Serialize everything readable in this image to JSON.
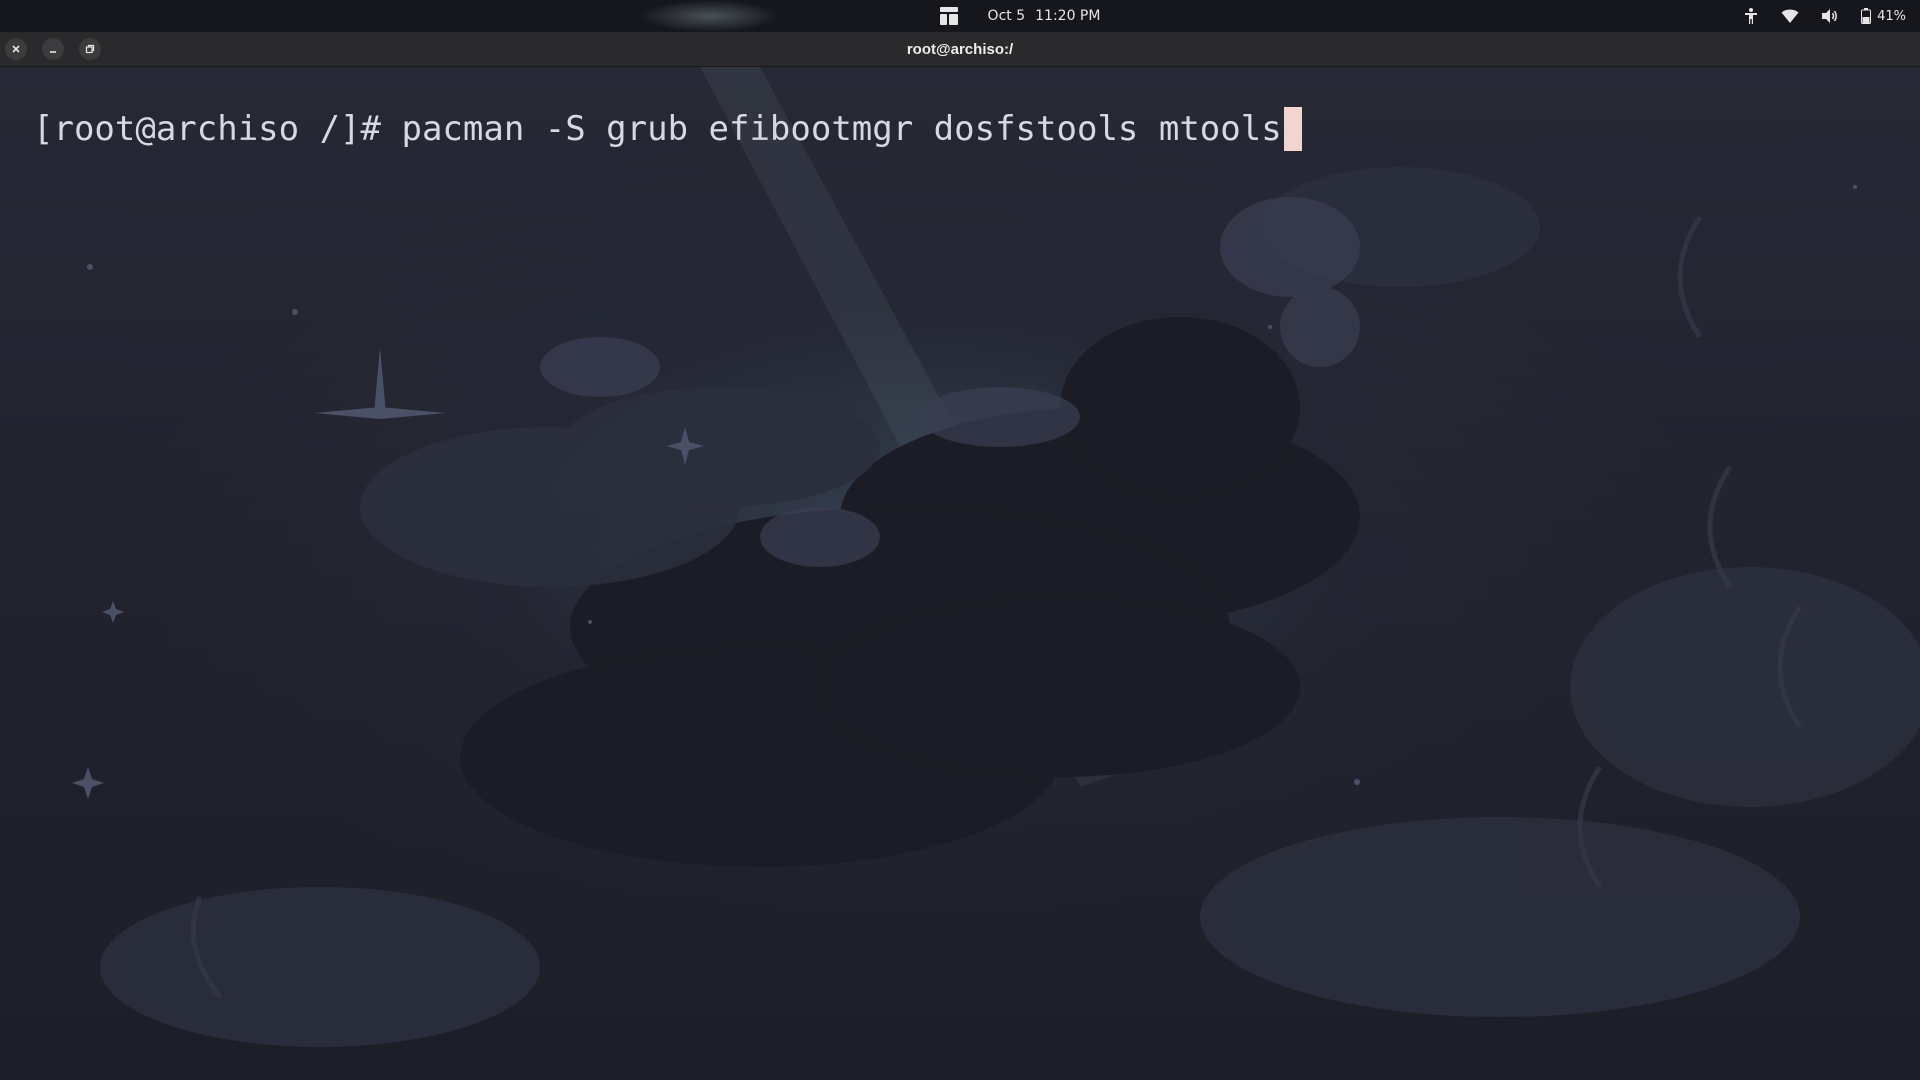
{
  "topbar": {
    "date": "Oct 5",
    "time": "11:20 PM",
    "battery": "41%",
    "icons": [
      "activities-icon",
      "accessibility-icon",
      "wifi-icon",
      "volume-icon",
      "battery-icon"
    ]
  },
  "window": {
    "title": "root@archiso:/",
    "controls": [
      "close-icon",
      "minimize-icon",
      "restore-icon"
    ]
  },
  "terminal": {
    "prompt": "[root@archiso /]# ",
    "command": "pacman -S grub efibootmgr dosfstools mtools",
    "cursor_color": "#f2d5cf",
    "text_color": "#d6d9e4"
  }
}
